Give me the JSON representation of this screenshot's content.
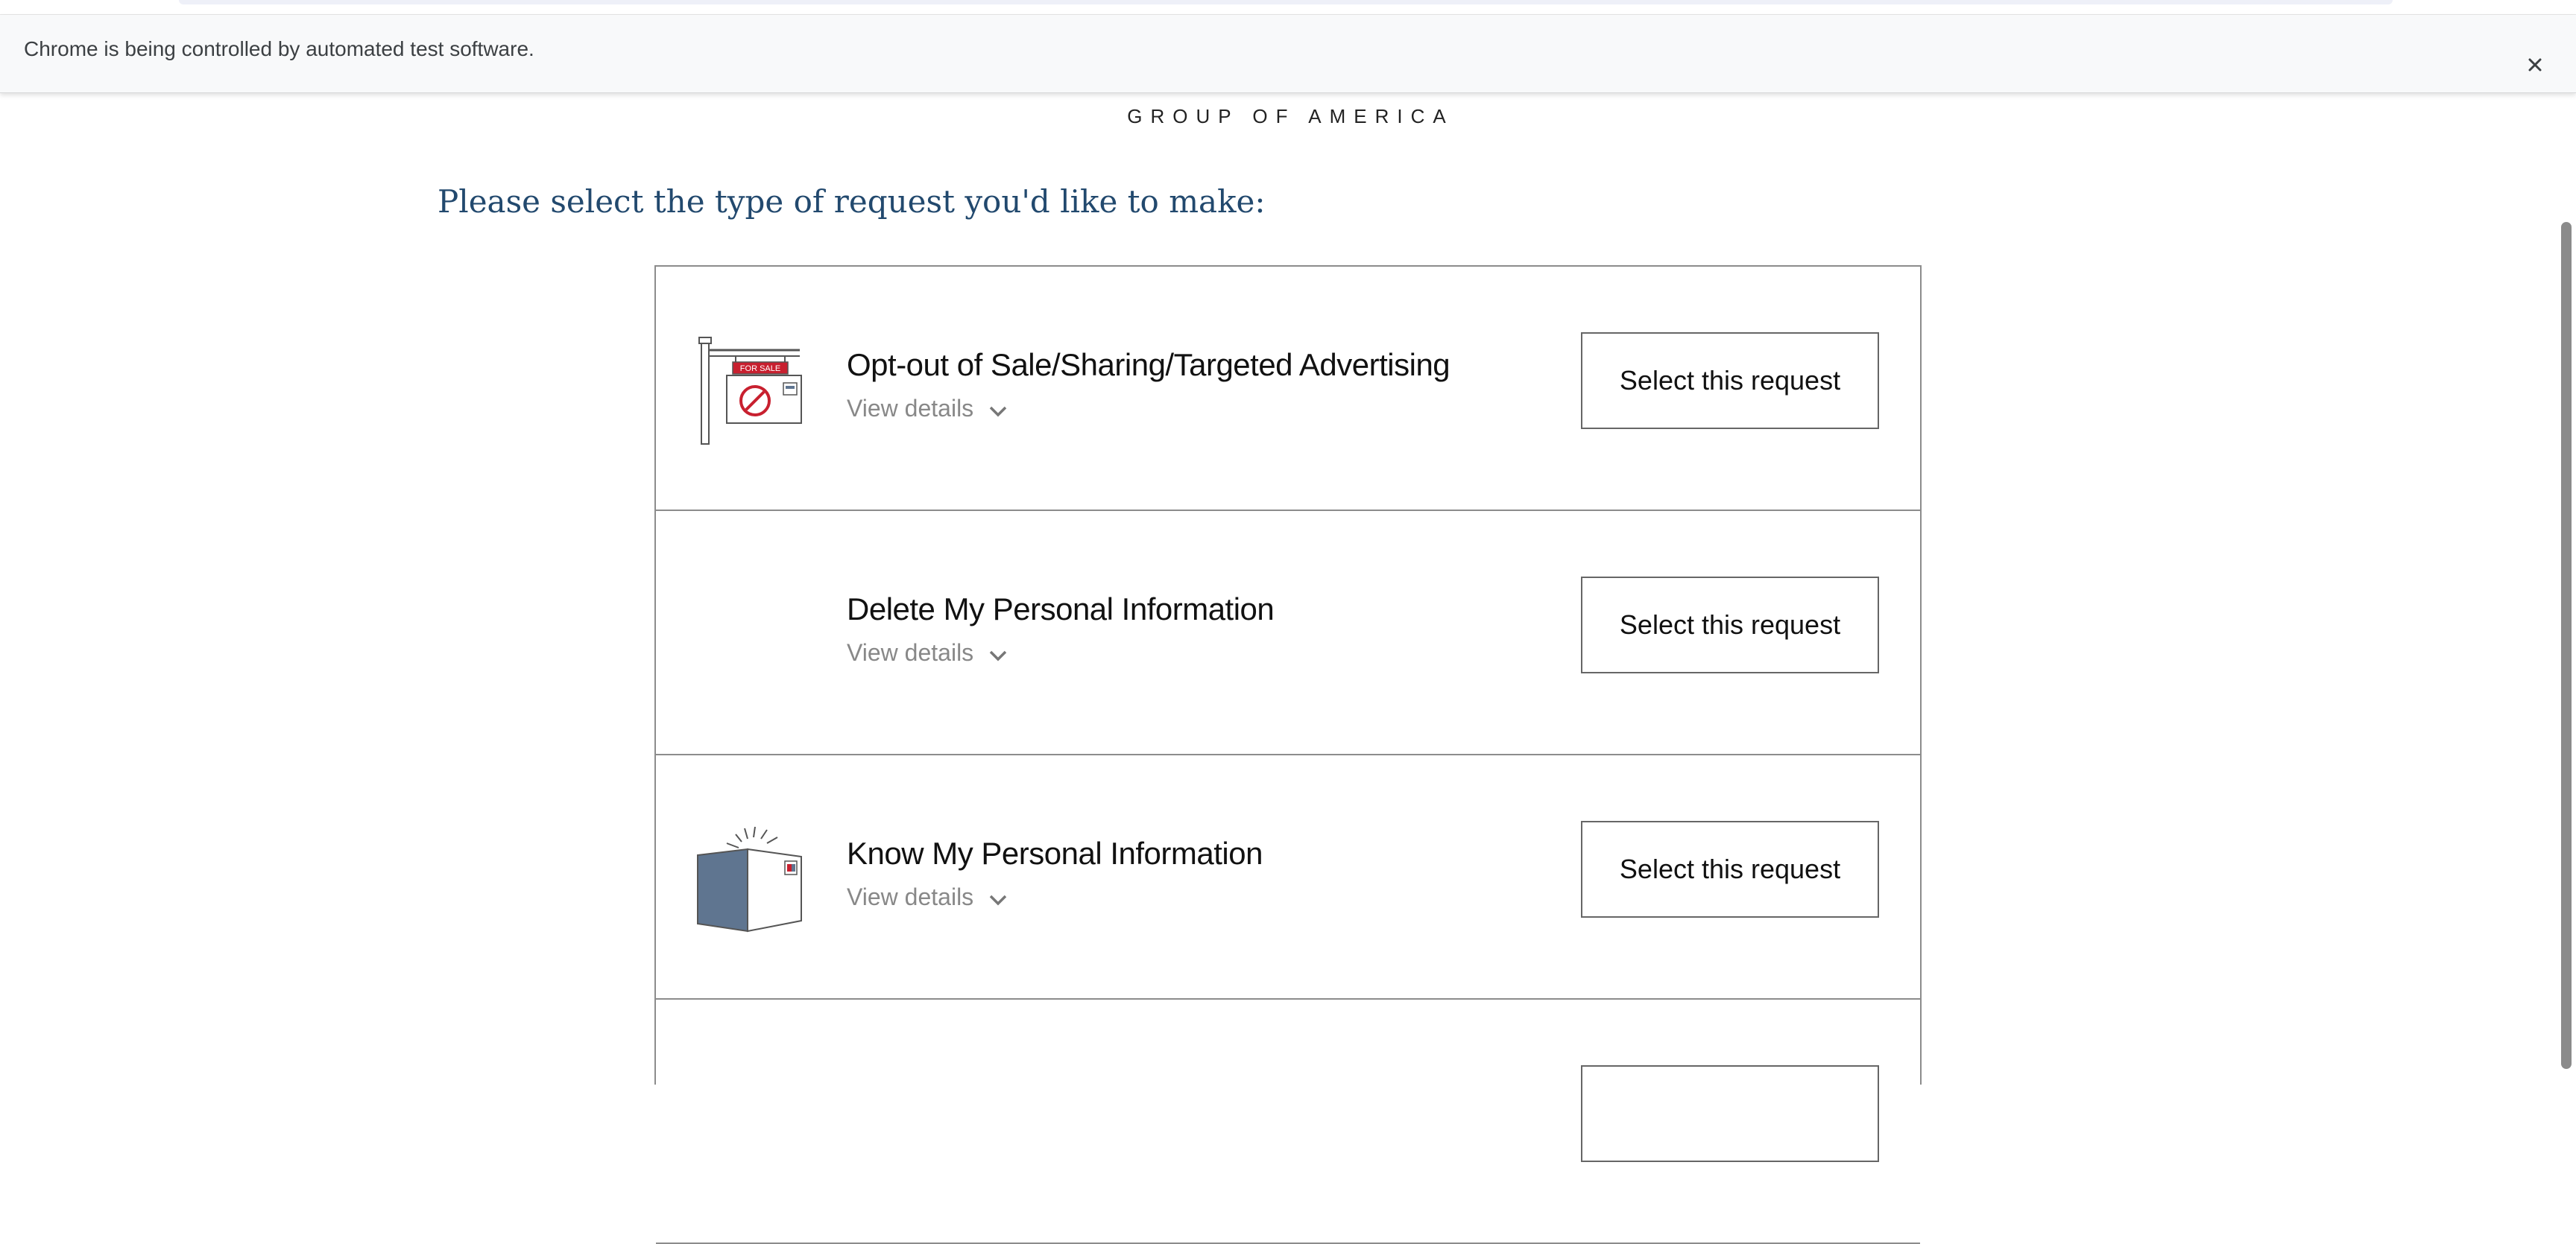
{
  "browser": {
    "infobar_text": "Chrome is being controlled by automated test software.",
    "close_icon": "close-icon"
  },
  "header": {
    "brand_subtitle": "GROUP OF AMERICA"
  },
  "main": {
    "prompt": "Please select the type of request you'd like to make:",
    "requests": [
      {
        "icon": "for-sale-sign-icon",
        "title": "Opt-out of Sale/Sharing/Targeted Advertising",
        "details_label": "View details",
        "button_label": "Select this request"
      },
      {
        "icon": "",
        "title": "Delete My Personal Information",
        "details_label": "View details",
        "button_label": "Select this request"
      },
      {
        "icon": "open-book-icon",
        "title": "Know My Personal Information",
        "details_label": "View details",
        "button_label": "Select this request"
      }
    ]
  },
  "colors": {
    "prompt": "#22496e",
    "border": "#8c8c8c",
    "details": "#888888",
    "book_cover": "#5f7590",
    "sign_red": "#c8202f"
  }
}
